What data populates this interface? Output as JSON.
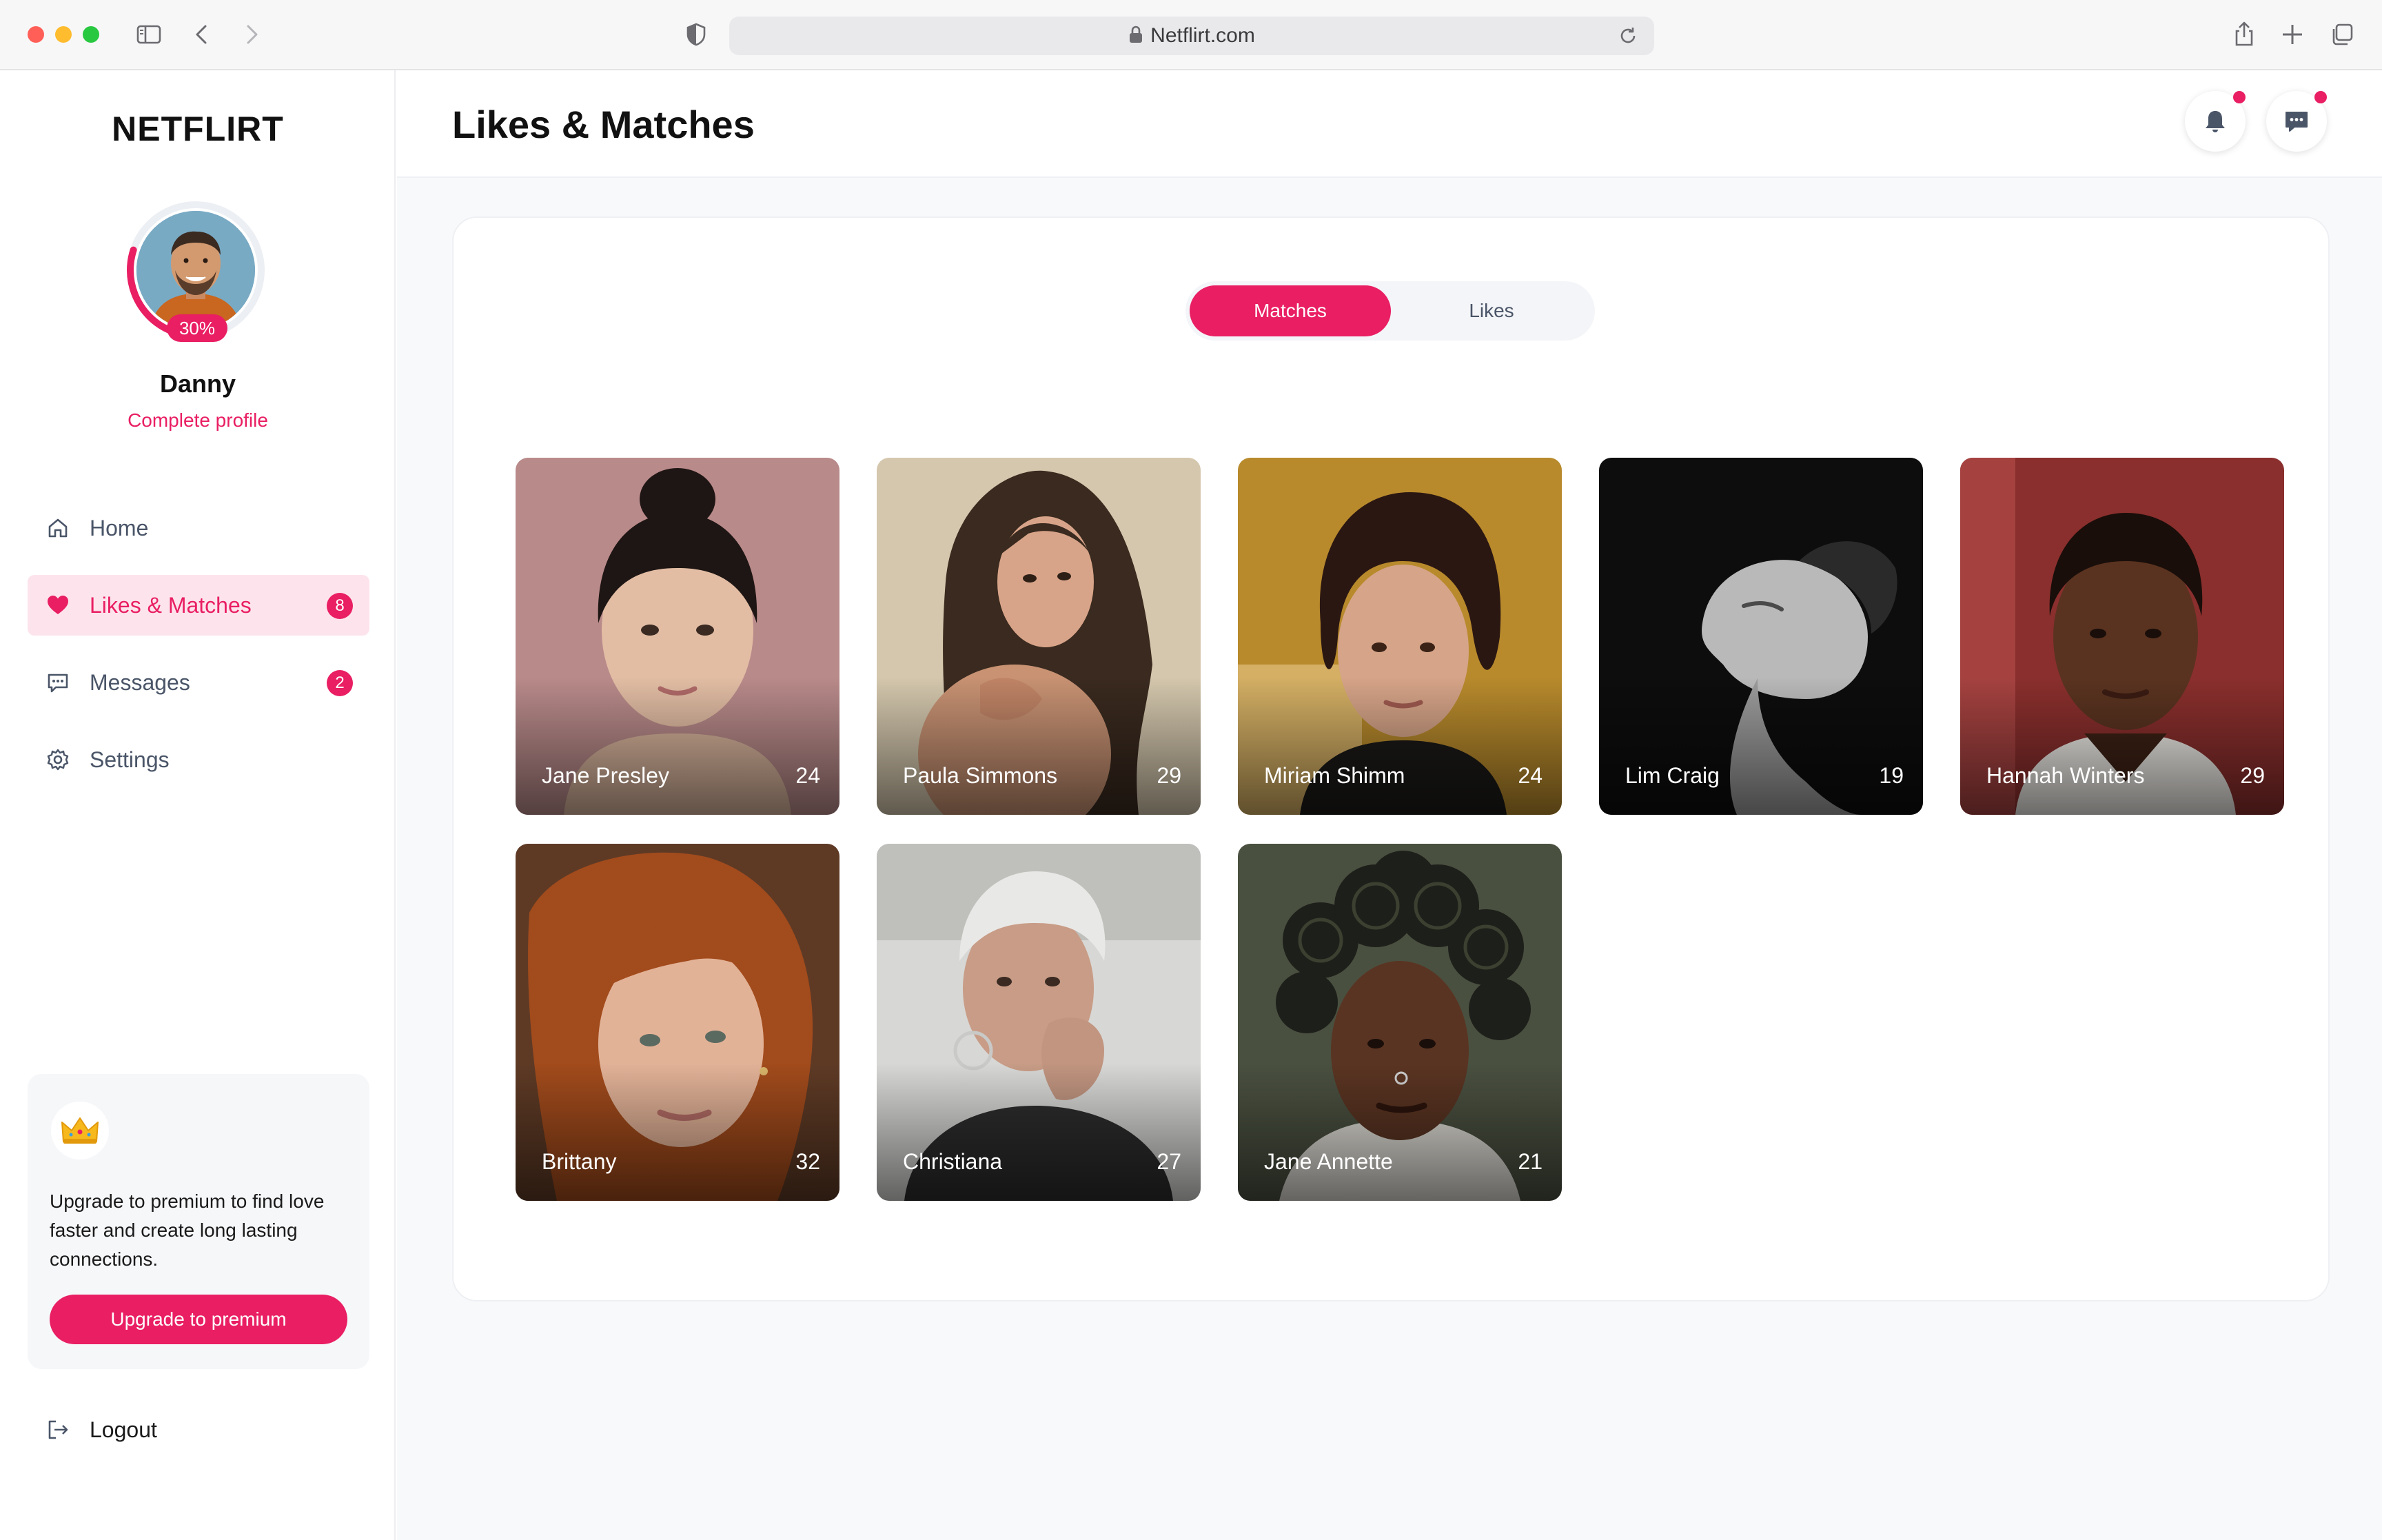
{
  "browser": {
    "url": "Netflirt.com"
  },
  "sidebar": {
    "brand": "NETFLIRT",
    "user": {
      "name": "Danny",
      "profile_progress": "30%",
      "profile_progress_value": 0.3,
      "complete_profile_link": "Complete profile"
    },
    "nav": [
      {
        "label": "Home",
        "icon": "home-icon",
        "active": false
      },
      {
        "label": "Likes & Matches",
        "icon": "heart-icon",
        "active": true,
        "badge": "8"
      },
      {
        "label": "Messages",
        "icon": "chat-icon",
        "active": false,
        "badge": "2"
      },
      {
        "label": "Settings",
        "icon": "gear-icon",
        "active": false
      }
    ],
    "upgrade": {
      "icon": "crown-icon",
      "text": "Upgrade to premium to find love faster and create long lasting connections.",
      "button": "Upgrade to premium"
    },
    "logout": "Logout"
  },
  "header": {
    "title": "Likes & Matches",
    "notifications_icon": "bell-icon",
    "messages_icon": "chat-icon"
  },
  "tabs": {
    "active": "Matches",
    "inactive": "Likes"
  },
  "matches": [
    {
      "name": "Jane Presley",
      "age": "24"
    },
    {
      "name": "Paula Simmons",
      "age": "29"
    },
    {
      "name": "Miriam Shimm",
      "age": "24"
    },
    {
      "name": "Lim Craig",
      "age": "19"
    },
    {
      "name": "Hannah Winters",
      "age": "29"
    },
    {
      "name": "Brittany",
      "age": "32"
    },
    {
      "name": "Christiana",
      "age": "27"
    },
    {
      "name": "Jane Annette",
      "age": "21"
    }
  ],
  "colors": {
    "accent": "#e91e63",
    "accent_light": "#fde4ec",
    "text_muted": "#4a5568"
  }
}
